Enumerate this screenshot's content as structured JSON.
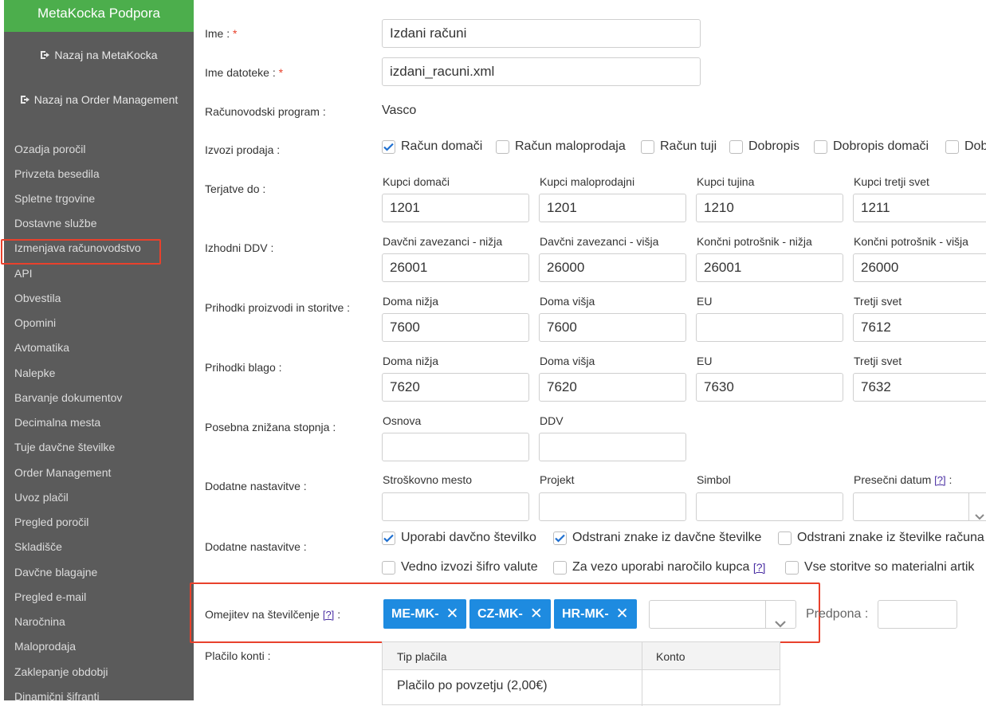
{
  "sidebar": {
    "title": "MetaKocka Podpora",
    "links": [
      {
        "label": "Nazaj na MetaKocka"
      },
      {
        "label": "Nazaj na Order Management"
      }
    ],
    "items": [
      {
        "label": "Ozadja poročil"
      },
      {
        "label": "Privzeta besedila"
      },
      {
        "label": "Spletne trgovine"
      },
      {
        "label": "Dostavne službe"
      },
      {
        "label": "Izmenjava računovodstvo",
        "active": true
      },
      {
        "label": "API"
      },
      {
        "label": "Obvestila"
      },
      {
        "label": "Opomini"
      },
      {
        "label": "Avtomatika"
      },
      {
        "label": "Nalepke"
      },
      {
        "label": "Barvanje dokumentov"
      },
      {
        "label": "Decimalna mesta"
      },
      {
        "label": "Tuje davčne številke"
      },
      {
        "label": "Order Management"
      },
      {
        "label": "Uvoz plačil"
      },
      {
        "label": "Pregled poročil"
      },
      {
        "label": "Skladišče"
      },
      {
        "label": "Davčne blagajne"
      },
      {
        "label": "Pregled e-mail"
      },
      {
        "label": "Naročnina"
      },
      {
        "label": "Maloprodaja"
      },
      {
        "label": "Zaklepanje obdobji"
      },
      {
        "label": "Dinamični šifranti"
      }
    ]
  },
  "form": {
    "name": {
      "label": "Ime :",
      "required": "*",
      "value": "Izdani računi"
    },
    "filename": {
      "label": "Ime datoteke :",
      "required": "*",
      "value": "izdani_racuni.xml"
    },
    "program": {
      "label": "Računovodski program :",
      "value": "Vasco"
    },
    "exports": {
      "label": "Izvozi prodaja :",
      "options": [
        {
          "label": "Račun domači",
          "checked": true
        },
        {
          "label": "Račun maloprodaja",
          "checked": false
        },
        {
          "label": "Račun tuji",
          "checked": false
        },
        {
          "label": "Dobropis",
          "checked": false
        },
        {
          "label": "Dobropis domači",
          "checked": false
        },
        {
          "label": "Dob",
          "checked": false
        }
      ]
    },
    "receivables": {
      "label": "Terjatve do :",
      "fields": [
        {
          "label": "Kupci domači",
          "value": "1201"
        },
        {
          "label": "Kupci maloprodajni",
          "value": "1201"
        },
        {
          "label": "Kupci tujina",
          "value": "1210"
        },
        {
          "label": "Kupci tretji svet",
          "value": "1211"
        }
      ]
    },
    "vat_out": {
      "label": "Izhodni DDV :",
      "fields": [
        {
          "label": "Davčni zavezanci - nižja",
          "value": "26001"
        },
        {
          "label": "Davčni zavezanci - višja",
          "value": "26000"
        },
        {
          "label": "Končni potrošnik - nižja",
          "value": "26001"
        },
        {
          "label": "Končni potrošnik - višja",
          "value": "26000"
        }
      ]
    },
    "revenue_services": {
      "label": "Prihodki proizvodi in storitve :",
      "fields": [
        {
          "label": "Doma nižja",
          "value": "7600"
        },
        {
          "label": "Doma višja",
          "value": "7600"
        },
        {
          "label": "EU",
          "value": ""
        },
        {
          "label": "Tretji svet",
          "value": "7612"
        }
      ]
    },
    "revenue_goods": {
      "label": "Prihodki blago :",
      "fields": [
        {
          "label": "Doma nižja",
          "value": "7620"
        },
        {
          "label": "Doma višja",
          "value": "7620"
        },
        {
          "label": "EU",
          "value": "7630"
        },
        {
          "label": "Tretji svet",
          "value": "7632"
        }
      ]
    },
    "special_rate": {
      "label": "Posebna znižana stopnja :",
      "fields": [
        {
          "label": "Osnova",
          "value": ""
        },
        {
          "label": "DDV",
          "value": ""
        }
      ]
    },
    "extra1": {
      "label": "Dodatne nastavitve :",
      "fields": [
        {
          "label": "Stroškovno mesto",
          "value": ""
        },
        {
          "label": "Projekt",
          "value": ""
        },
        {
          "label": "Simbol",
          "value": ""
        },
        {
          "label": "Presečni datum",
          "help": "[?]",
          "suffix": ":",
          "value": ""
        }
      ]
    },
    "extra2": {
      "label": "Dodatne nastavitve :",
      "row1": [
        {
          "label": "Uporabi davčno številko",
          "checked": true
        },
        {
          "label": "Odstrani znake iz davčne številke",
          "checked": true
        },
        {
          "label": "Odstrani znake iz številke računa",
          "checked": false
        }
      ],
      "row2": [
        {
          "label": "Vedno izvozi šifro valute",
          "checked": false
        },
        {
          "label": "Za vezo uporabi naročilo kupca",
          "help": "[?]",
          "checked": false
        },
        {
          "label": "Vse storitve so materialni artik",
          "checked": false
        }
      ]
    },
    "numbering": {
      "label": "Omejitev na številčenje",
      "help": "[?]",
      "suffix": ":",
      "tags": [
        {
          "label": "ME-MK-"
        },
        {
          "label": "CZ-MK-"
        },
        {
          "label": "HR-MK-"
        }
      ],
      "prefix_label": "Predpona :",
      "prefix_value": ""
    },
    "payment": {
      "label": "Plačilo konti :",
      "columns": [
        "Tip plačila",
        "Konto"
      ],
      "rows": [
        {
          "type": "Plačilo po povzetju (2,00€)",
          "account": ""
        }
      ]
    }
  },
  "colors": {
    "sidebar_bg": "#5b5b5b",
    "header_green": "#4cae4c",
    "tag_blue": "#1e8be0",
    "highlight_red": "#e8412c",
    "check_blue": "#1e6fd0"
  }
}
